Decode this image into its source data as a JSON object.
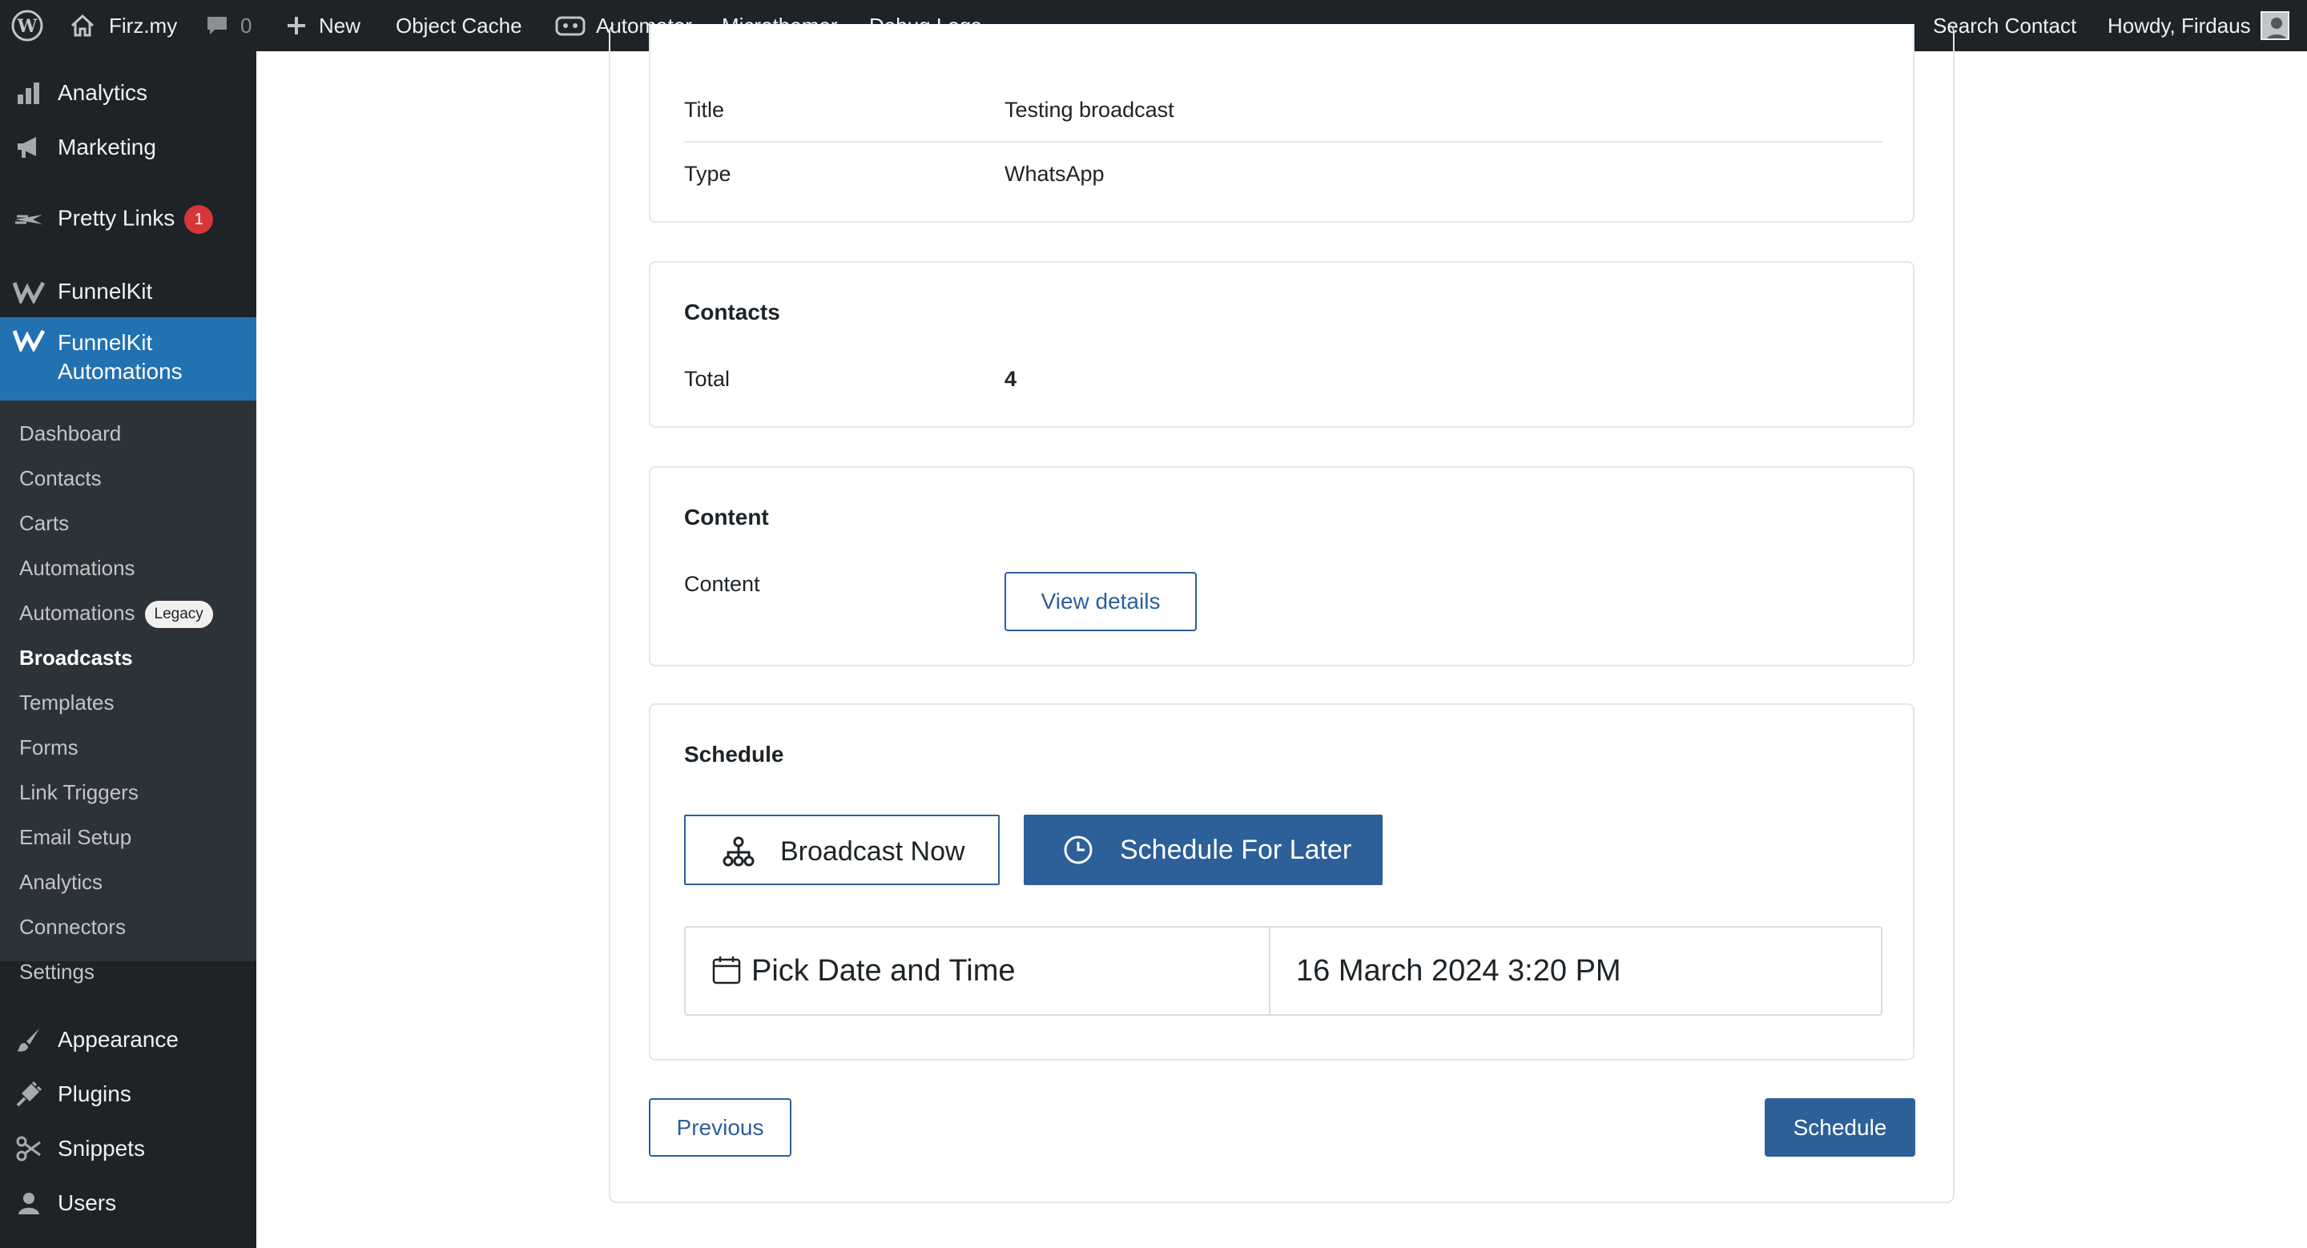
{
  "admin_bar": {
    "site_name": "Firz.my",
    "comments_count": "0",
    "new_label": "New",
    "object_cache": "Object Cache",
    "automator": "Automator",
    "microthemer": "Microthemer",
    "debug_logs": "Debug Logs",
    "search_contact": "Search Contact",
    "howdy": "Howdy, Firdaus"
  },
  "sidebar": {
    "top_items": [
      {
        "label": "Analytics",
        "icon": "bar-chart-icon"
      },
      {
        "label": "Marketing",
        "icon": "megaphone-icon"
      },
      {
        "label": "Pretty Links",
        "icon": "pretty-links-icon",
        "badge": "1"
      },
      {
        "label": "FunnelKit",
        "icon": "funnelkit-icon"
      },
      {
        "label": "FunnelKit Automations",
        "icon": "funnelkit-icon"
      }
    ],
    "sub_items": [
      {
        "label": "Dashboard"
      },
      {
        "label": "Contacts"
      },
      {
        "label": "Carts"
      },
      {
        "label": "Automations"
      },
      {
        "label": "Automations",
        "badge": "Legacy"
      },
      {
        "label": "Broadcasts"
      },
      {
        "label": "Templates"
      },
      {
        "label": "Forms"
      },
      {
        "label": "Link Triggers"
      },
      {
        "label": "Email Setup"
      },
      {
        "label": "Analytics"
      },
      {
        "label": "Connectors"
      },
      {
        "label": "Settings"
      }
    ],
    "bottom_items": [
      {
        "label": "Appearance",
        "icon": "paintbrush-icon"
      },
      {
        "label": "Plugins",
        "icon": "plug-icon"
      },
      {
        "label": "Snippets",
        "icon": "scissors-icon"
      },
      {
        "label": "Users",
        "icon": "user-icon"
      }
    ]
  },
  "details": {
    "title_label": "Title",
    "title_value": "Testing broadcast",
    "type_label": "Type",
    "type_value": "WhatsApp"
  },
  "contacts": {
    "heading": "Contacts",
    "total_label": "Total",
    "total_value": "4"
  },
  "content": {
    "heading": "Content",
    "label": "Content",
    "view_button": "View details"
  },
  "schedule": {
    "heading": "Schedule",
    "broadcast_now": "Broadcast Now",
    "schedule_later": "Schedule For Later",
    "pick_label": "Pick Date and Time",
    "datetime_value": "16 March 2024 3:20 PM"
  },
  "footer": {
    "previous": "Previous",
    "schedule": "Schedule"
  },
  "colors": {
    "admin_bg": "#1d2327",
    "accent": "#2271b1",
    "button_blue": "#2d5f99",
    "badge_red": "#d63638"
  }
}
